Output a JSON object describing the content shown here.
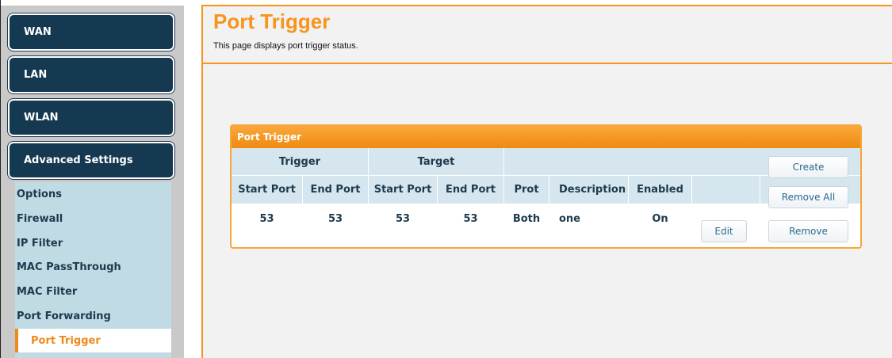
{
  "sidebar": {
    "nav_items": [
      "WAN",
      "LAN",
      "WLAN",
      "Advanced Settings"
    ],
    "sub_items": [
      "Options",
      "Firewall",
      "IP Filter",
      "MAC PassThrough",
      "MAC Filter",
      "Port Forwarding",
      "Port Trigger"
    ],
    "active_sub_item": "Port Trigger"
  },
  "page": {
    "title": "Port Trigger",
    "description": "This page displays port trigger status."
  },
  "panel": {
    "title": "Port Trigger",
    "group_headers": {
      "trigger": "Trigger",
      "target": "Target"
    },
    "columns": [
      "Start Port",
      "End Port",
      "Start Port",
      "End Port",
      "Prot",
      "Description",
      "Enabled"
    ],
    "buttons": {
      "create": "Create",
      "remove_all": "Remove All",
      "edit": "Edit",
      "remove": "Remove"
    },
    "rows": [
      {
        "trigger_start": "53",
        "trigger_end": "53",
        "target_start": "53",
        "target_end": "53",
        "prot": "Both",
        "description": "one",
        "enabled": "On"
      }
    ]
  },
  "colors": {
    "accent": "#f7941d",
    "nav_bg": "#143951",
    "table_header_bg": "#d6e6ee",
    "submenu_bg": "#c1dbe5"
  }
}
